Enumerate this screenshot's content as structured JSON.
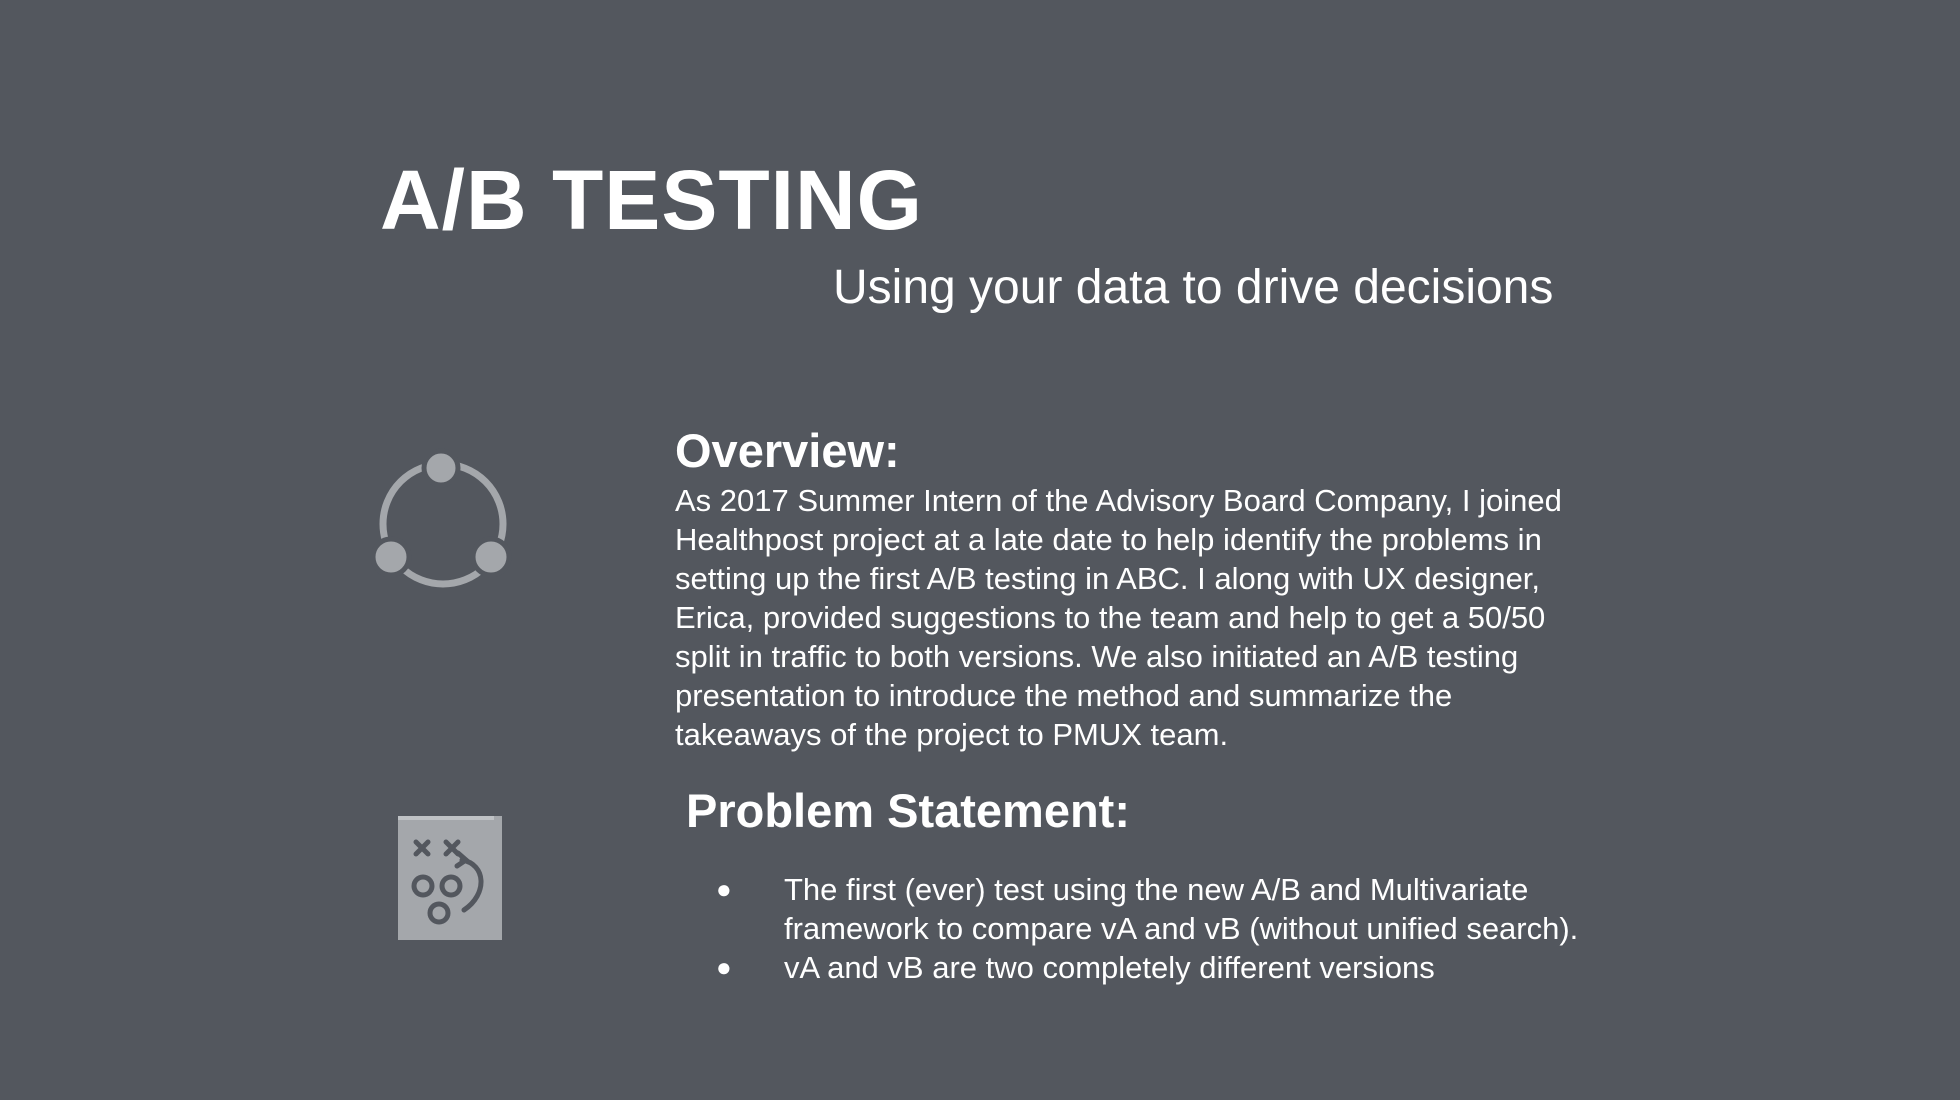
{
  "slide": {
    "title": "A/B TESTING",
    "subtitle": "Using your data to drive decisions"
  },
  "overview": {
    "icon": "share-network-icon",
    "heading": "Overview:",
    "body": "As 2017 Summer Intern of the Advisory Board Company, I joined Healthpost project at a late date to help identify the problems in setting up the first A/B testing in ABC. I along with UX designer, Erica, provided suggestions to the team and help to get a 50/50 split in traffic to both versions. We also initiated an A/B testing presentation to introduce the method and summarize the takeaways of the project to PMUX team."
  },
  "problem": {
    "icon": "playbook-icon",
    "heading": "Problem Statement:",
    "bullets": [
      "The first (ever) test using the new A/B and Multivariate framework to compare vA and vB (without unified search).",
      "vA and vB are two completely different versions"
    ]
  },
  "colors": {
    "background": "#53575e",
    "text": "#ffffff",
    "icon": "#a4a7ab"
  }
}
